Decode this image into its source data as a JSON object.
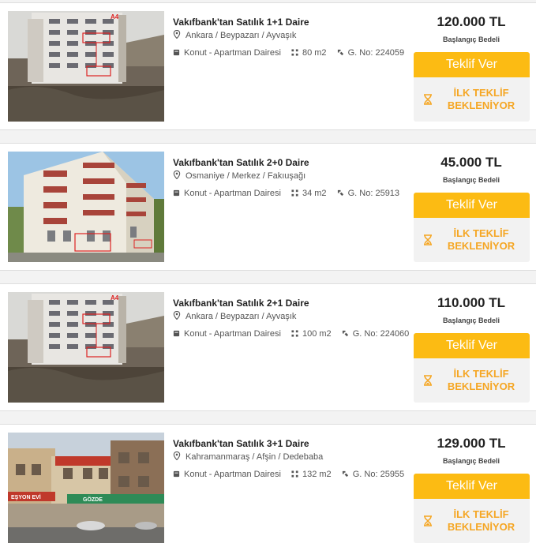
{
  "listings": [
    {
      "title": "Vakıfbank'tan Satılık 1+1 Daire",
      "location": "Ankara / Beypazarı / Ayvaşık",
      "type": "Konut - Apartman Dairesi",
      "area": "80 m2",
      "gno_label": "G. No:",
      "gno": "224059",
      "price": "120.000 TL",
      "price_label": "Başlangıç Bedeli",
      "offer_label": "Teklif Ver",
      "wait_line1": "İLK TEKLİF",
      "wait_line2": "BEKLENİYOR"
    },
    {
      "title": "Vakıfbank'tan Satılık 2+0 Daire",
      "location": "Osmaniye / Merkez / Fakıuşağı",
      "type": "Konut - Apartman Dairesi",
      "area": "34 m2",
      "gno_label": "G. No:",
      "gno": "25913",
      "price": "45.000 TL",
      "price_label": "Başlangıç Bedeli",
      "offer_label": "Teklif Ver",
      "wait_line1": "İLK TEKLİF",
      "wait_line2": "BEKLENİYOR"
    },
    {
      "title": "Vakıfbank'tan Satılık 2+1 Daire",
      "location": "Ankara / Beypazarı / Ayvaşık",
      "type": "Konut - Apartman Dairesi",
      "area": "100 m2",
      "gno_label": "G. No:",
      "gno": "224060",
      "price": "110.000 TL",
      "price_label": "Başlangıç Bedeli",
      "offer_label": "Teklif Ver",
      "wait_line1": "İLK TEKLİF",
      "wait_line2": "BEKLENİYOR"
    },
    {
      "title": "Vakıfbank'tan Satılık 3+1 Daire",
      "location": "Kahramanmaraş / Afşin / Dedebaba",
      "type": "Konut - Apartman Dairesi",
      "area": "132 m2",
      "gno_label": "G. No:",
      "gno": "25955",
      "price": "129.000 TL",
      "price_label": "Başlangıç Bedeli",
      "offer_label": "Teklif Ver",
      "wait_line1": "İLK TEKLİF",
      "wait_line2": "BEKLENİYOR"
    }
  ],
  "photo_text": {
    "tag": "A4",
    "shop_sign": "EŞYON EVİ",
    "banner": "GÖZDE"
  },
  "colors": {
    "accent": "#fcbb13",
    "waiting_text": "#f5a623"
  }
}
